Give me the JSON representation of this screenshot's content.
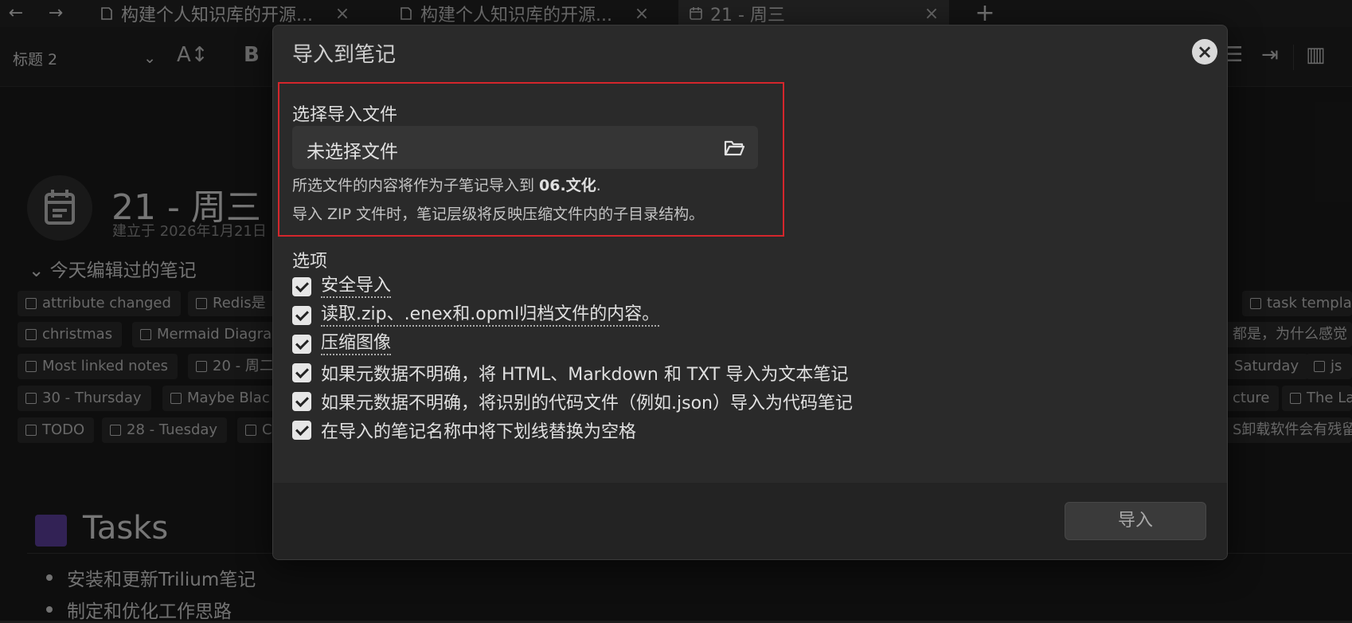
{
  "tabs": [
    {
      "label": "构建个人知识库的开源...",
      "active": false
    },
    {
      "label": "构建个人知识库的开源...",
      "active": false
    },
    {
      "label": "21 - 周三",
      "active": true
    }
  ],
  "nav": {
    "back": "←",
    "forward": "→",
    "new_tab": "+",
    "close": "×"
  },
  "toolbar": {
    "heading_select": "标题 2",
    "bold": "B",
    "font_size_icon": "A↕"
  },
  "note": {
    "title": "21 - 周三",
    "created": "建立于 2026年1月21日",
    "edited_section": "今天编辑过的笔记",
    "chips": [
      "attribute changed",
      "Redis是",
      "task templat",
      "christmas",
      "Mermaid Diagra",
      "都是，为什么感觉",
      "Most linked notes",
      "20 - 周二",
      "Saturday",
      "js",
      "30 - Thursday",
      "Maybe Blac",
      "cture",
      "The La",
      "TODO",
      "28 - Tuesday",
      "C",
      "S卸载软件会有残留"
    ],
    "tasks_title": "Tasks",
    "tasks": [
      "安装和更新Trilium笔记",
      "制定和优化工作思路"
    ]
  },
  "modal": {
    "title": "导入到笔记",
    "close_label": "×",
    "file_section_label": "选择导入文件",
    "file_input_value": "未选择文件",
    "help_line1_prefix": "所选文件的内容将作为子笔记导入到 ",
    "help_line1_note": "06.文化",
    "help_line1_suffix": ".",
    "help_line2": "导入 ZIP 文件时，笔记层级将反映压缩文件内的子目录结构。",
    "options_label": "选项",
    "options": [
      {
        "label": "安全导入",
        "checked": true
      },
      {
        "label": "读取.zip、.enex和.opml归档文件的内容。",
        "checked": true
      },
      {
        "label": "压缩图像",
        "checked": true
      },
      {
        "label": "如果元数据不明确，将 HTML、Markdown 和 TXT 导入为文本笔记",
        "checked": true
      },
      {
        "label": "如果元数据不明确，将识别的代码文件（例如.json）导入为代码笔记",
        "checked": true
      },
      {
        "label": "在导入的笔记名称中将下划线替换为空格",
        "checked": true
      }
    ],
    "import_button": "导入"
  },
  "colors": {
    "highlight_border": "#d4262c",
    "modal_bg": "#2a2a2a",
    "tasks_check": "#5b3e9b"
  }
}
